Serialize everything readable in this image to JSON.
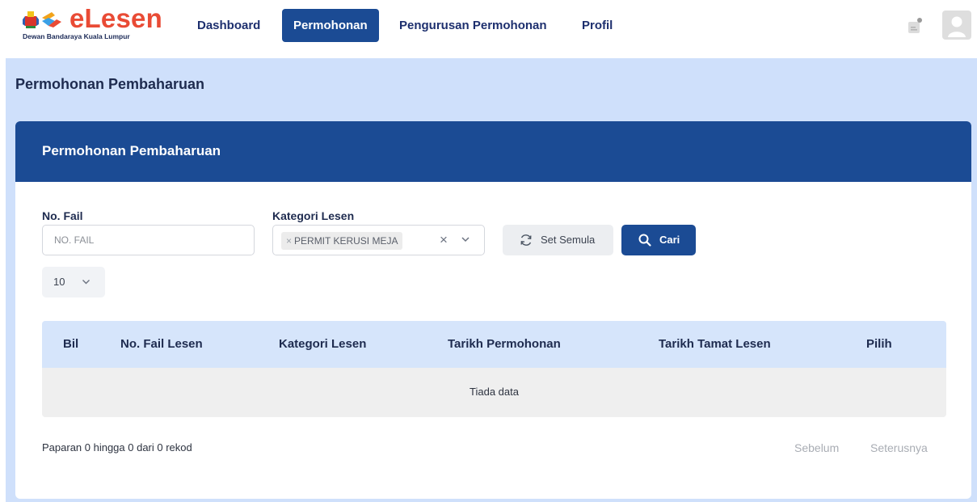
{
  "app": {
    "logo_text": "eLesen",
    "logo_subtitle": "Dewan Bandaraya Kuala Lumpur",
    "brand_color": "#1b4b94",
    "logo_color": "#e94b35"
  },
  "nav": {
    "items": [
      {
        "label": "Dashboard",
        "active": false
      },
      {
        "label": "Permohonan",
        "active": true
      },
      {
        "label": "Pengurusan Permohonan",
        "active": false
      },
      {
        "label": "Profil",
        "active": false
      }
    ],
    "icons": [
      "notification-icon",
      "user-avatar-icon"
    ]
  },
  "page": {
    "title": "Permohonan Pembaharuan",
    "background": "#cfe0fb"
  },
  "card": {
    "title": "Permohonan Pembaharuan"
  },
  "filters": {
    "no_fail": {
      "label": "No. Fail",
      "value": "",
      "placeholder": "NO. FAIL"
    },
    "kategori": {
      "label": "Kategori Lesen",
      "selected": [
        "PERMIT KERUSI MEJA"
      ],
      "tag_remove": "×",
      "clear": "×"
    },
    "reset_label": "Set Semula",
    "search_label": "Cari",
    "page_size": "10"
  },
  "table": {
    "columns": [
      "Bil",
      "No. Fail Lesen",
      "Kategori Lesen",
      "Tarikh Permohonan",
      "Tarikh Tamat Lesen",
      "Pilih"
    ],
    "rows": [],
    "empty_text": "Tiada data"
  },
  "pagination": {
    "info": "Paparan 0 hingga 0 dari 0 rekod",
    "prev": "Sebelum",
    "next": "Seterusnya"
  }
}
